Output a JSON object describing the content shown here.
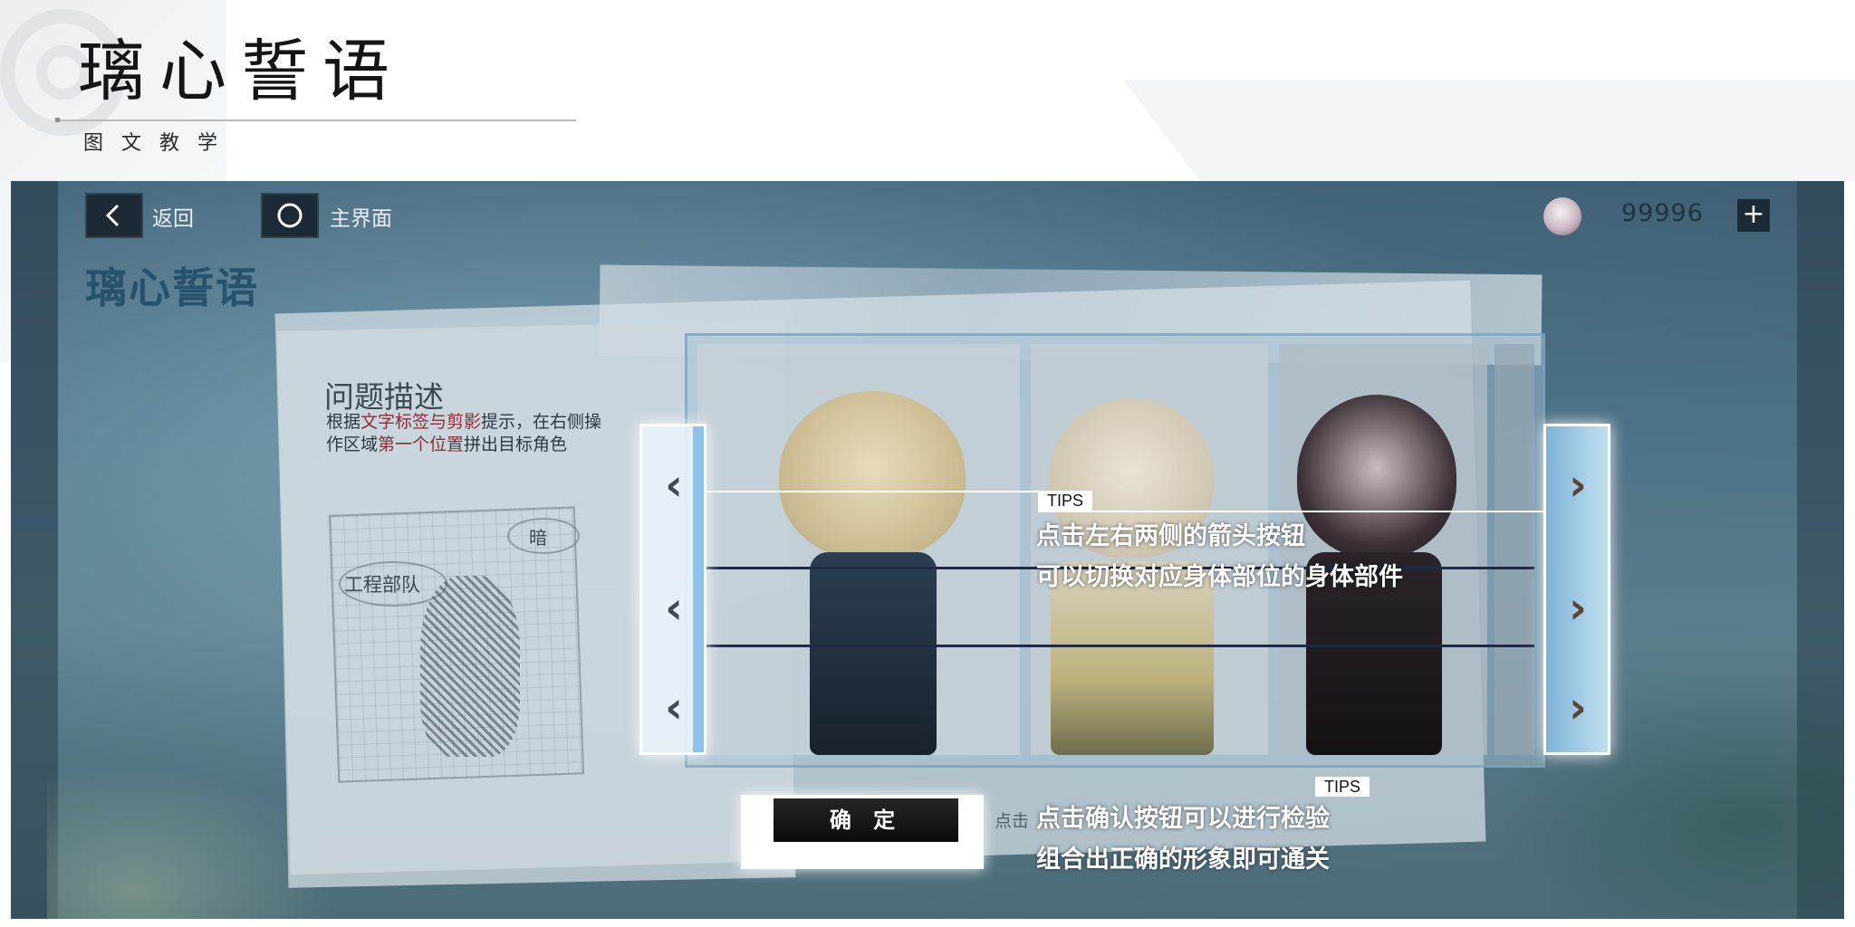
{
  "header": {
    "title": "璃心誓语",
    "subtitle": "图文教学"
  },
  "game": {
    "top_bar": {
      "back_label": "返回",
      "home_label": "主界面",
      "currency_value": "99996",
      "plus_label": "+"
    },
    "title": "璃心誓语",
    "problem": {
      "title": "问题描述",
      "desc_prefix": "根据",
      "desc_hl1": "文字标签与剪影",
      "desc_mid": "提示，在右侧操作区域",
      "desc_hl2": "第一个位置",
      "desc_suffix": "拼出目标角色",
      "label_dark": "暗",
      "label_team": "工程部队"
    },
    "tips": [
      {
        "tag": "TIPS",
        "lines": [
          "点击左右两侧的箭头按钮",
          "可以切换对应身体部位的身体部件"
        ]
      },
      {
        "tag": "TIPS",
        "lines": [
          "点击确认按钮可以进行检验",
          "组合出正确的形象即可通关"
        ]
      }
    ],
    "confirm_label": "确 定",
    "confirm_hint": "点击",
    "arrows": {
      "left": "‹",
      "right": "›"
    }
  },
  "colors": {
    "accent_blue": "#8cc4ee",
    "tip_text": "#ffffff",
    "highlight_red": "#8e2c3b"
  }
}
